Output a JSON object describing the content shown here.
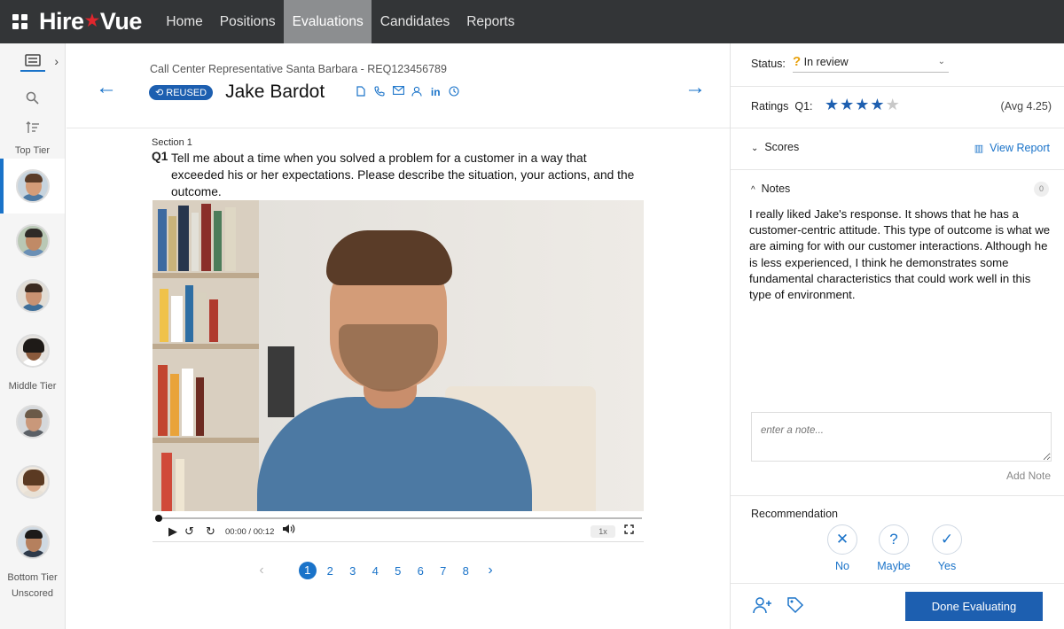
{
  "nav": {
    "logo_left": "Hire",
    "logo_right": "Vue",
    "tabs": [
      "Home",
      "Positions",
      "Evaluations",
      "Candidates",
      "Reports"
    ],
    "active_tab": "Evaluations"
  },
  "rail": {
    "tiers": {
      "top": "Top Tier",
      "middle": "Middle Tier",
      "bottom": "Bottom Tier",
      "unscored": "Unscored"
    }
  },
  "candidate": {
    "requisition": "Call Center Representative Santa Barbara - REQ123456789",
    "badge": "REUSED",
    "name": "Jake Bardot"
  },
  "question": {
    "section": "Section 1",
    "number": "Q1",
    "text": "Tell me about a time when you solved a problem for a customer in a way that exceeded his or her expectations. Please describe the situation, your actions, and the outcome."
  },
  "player": {
    "time": "00:00 / 00:12",
    "speed": "1x",
    "progress": 0
  },
  "pager": {
    "pages": [
      "1",
      "2",
      "3",
      "4",
      "5",
      "6",
      "7",
      "8"
    ],
    "current": "1"
  },
  "panel": {
    "status_label": "Status:",
    "status_value": "In review",
    "ratings_label": "Ratings",
    "ratings_q": "Q1:",
    "rating": 4,
    "rating_max": 5,
    "avg": "(Avg 4.25)",
    "scores_label": "Scores",
    "view_report": "View Report",
    "notes_label": "Notes",
    "notes_count": "0",
    "note_text": "I really liked Jake's response. It shows that he has a customer-centric attitude. This type of outcome is what we are aiming for with our customer interactions. Although he is less experienced, I think he demonstrates some fundamental characteristics that could work well in this type of environment.",
    "note_placeholder": "enter a note...",
    "add_note": "Add Note",
    "recommendation_label": "Recommendation",
    "rec_no": "No",
    "rec_maybe": "Maybe",
    "rec_yes": "Yes",
    "done_button": "Done Evaluating"
  },
  "colors": {
    "nav_bg": "#333537",
    "active_tab_bg": "#8c8e90",
    "accent": "#1a73c9",
    "primary_button": "#1d5fb0",
    "brand_star": "#e0262d",
    "status_icon": "#e8a10c"
  }
}
